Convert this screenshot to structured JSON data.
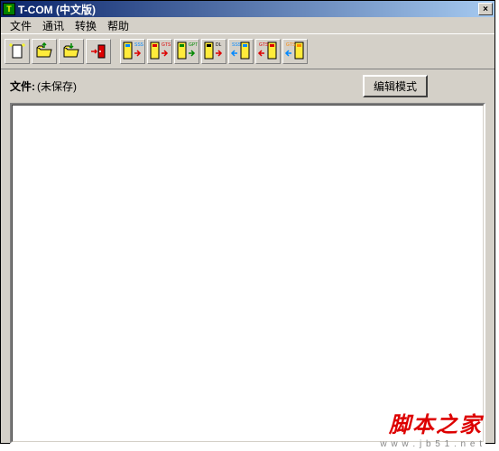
{
  "titlebar": {
    "title": "T-COM (中文版)",
    "close": "×"
  },
  "menu": {
    "file": "文件",
    "comm": "通讯",
    "convert": "转换",
    "help": "帮助"
  },
  "status": {
    "file_label": "文件:",
    "file_value": "(未保存)"
  },
  "buttons": {
    "edit_mode": "编辑模式"
  },
  "watermark": {
    "text": "脚本之家",
    "url": "w w w . j b 5 1 . n e t"
  }
}
